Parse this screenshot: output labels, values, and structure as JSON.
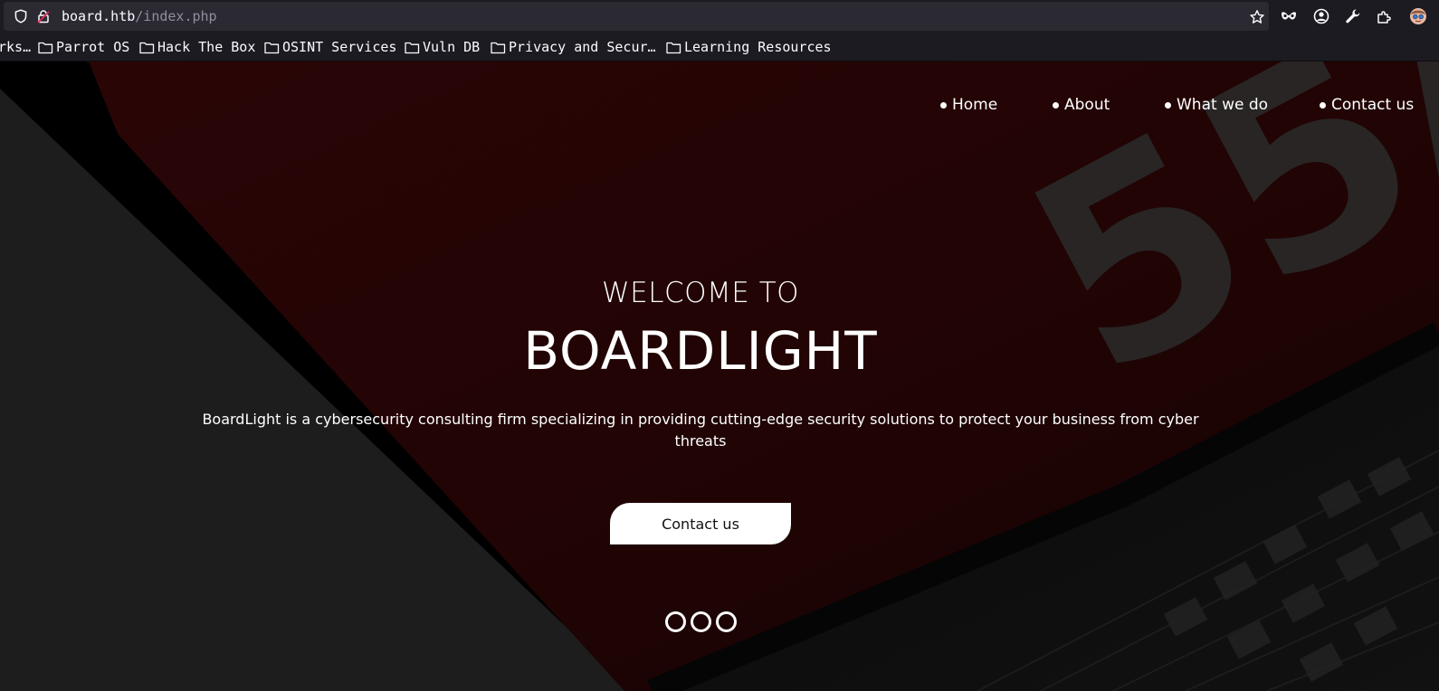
{
  "browser": {
    "url_host": "board.htb",
    "url_path": "/index.php",
    "bookmarks": [
      "rks…",
      "Parrot OS",
      "Hack The Box",
      "OSINT Services",
      "Vuln DB",
      "Privacy and Secur…",
      "Learning Resources"
    ],
    "icons": [
      "shield-icon",
      "lock-slash-icon",
      "star-icon",
      "mask-icon",
      "account-icon",
      "wrench-icon",
      "extensions-icon",
      "profile-avatar-icon"
    ]
  },
  "nav": {
    "items": [
      "Home",
      "About",
      "What we do",
      "Contact us"
    ]
  },
  "hero": {
    "pre_title": "WELCOME TO",
    "title": "BOARDLIGHT",
    "description": "BoardLight is a cybersecurity consulting firm specializing in providing cutting-edge security solutions to protect your business from cyber threats",
    "cta_label": "Contact us",
    "slides": 3,
    "laptop_text": "55/"
  },
  "colors": {
    "accent_red": "#2a0506",
    "background": "#1c1c1c",
    "text": "#ffffff"
  }
}
